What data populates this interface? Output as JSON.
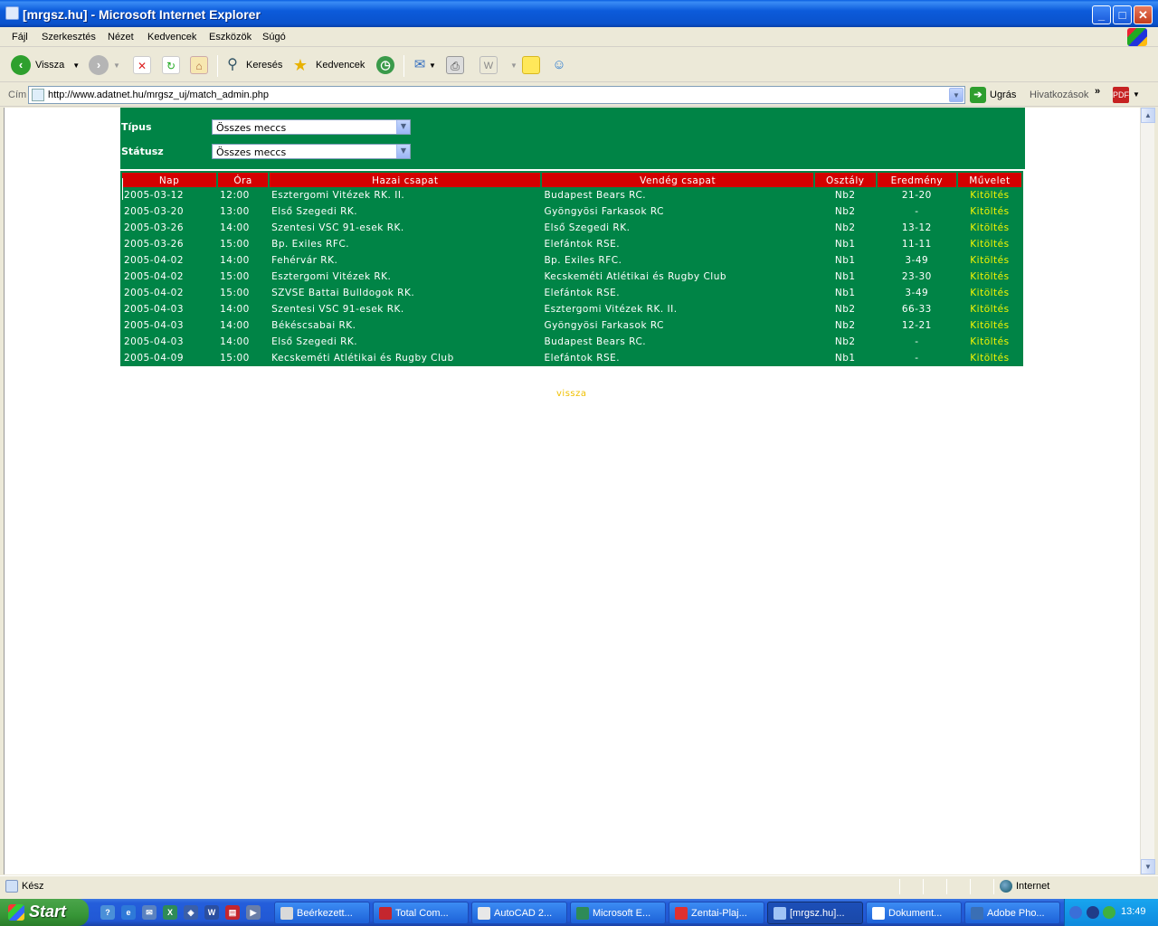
{
  "window": {
    "title": "[mrgsz.hu] - Microsoft Internet Explorer"
  },
  "menu": {
    "items": [
      "Fájl",
      "Szerkesztés",
      "Nézet",
      "Kedvencek",
      "Eszközök",
      "Súgó"
    ]
  },
  "toolbar": {
    "back_label": "Vissza",
    "search_label": "Keresés",
    "favorites_label": "Kedvencek"
  },
  "address": {
    "label": "Cím",
    "url": "http://www.adatnet.hu/mrgsz_uj/match_admin.php",
    "go_label": "Ugrás",
    "links_label": "Hivatkozások"
  },
  "filters": {
    "type_label": "Típus",
    "type_value": "Összes meccs",
    "status_label": "Státusz",
    "status_value": "Összes meccs"
  },
  "table": {
    "headers": [
      "Nap",
      "Óra",
      "Hazai csapat",
      "Vendég csapat",
      "Osztály",
      "Eredmény",
      "Művelet"
    ],
    "groups": [
      [
        [
          "2005-03-12",
          "12:00",
          "Esztergomi Vitézek RK. II.",
          "Budapest Bears RC.",
          "Nb2",
          "21-20",
          "Kitöltés"
        ]
      ],
      [
        [
          "2005-03-20",
          "13:00",
          "Első Szegedi RK.",
          "Gyöngyösi Farkasok RC",
          "Nb2",
          "-",
          "Kitöltés"
        ]
      ],
      [
        [
          "2005-03-26",
          "14:00",
          "Szentesi VSC 91-esek RK.",
          "Első Szegedi RK.",
          "Nb2",
          "13-12",
          "Kitöltés"
        ],
        [
          "2005-03-26",
          "15:00",
          "Bp. Exiles RFC.",
          "Elefántok RSE.",
          "Nb1",
          "11-11",
          "Kitöltés"
        ]
      ],
      [
        [
          "2005-04-02",
          "14:00",
          "Fehérvár RK.",
          "Bp. Exiles RFC.",
          "Nb1",
          "3-49",
          "Kitöltés"
        ],
        [
          "2005-04-02",
          "15:00",
          "Esztergomi Vitézek RK.",
          "Kecskeméti Atlétikai és Rugby Club",
          "Nb1",
          "23-30",
          "Kitöltés"
        ],
        [
          "2005-04-02",
          "15:00",
          "SZVSE Battai Bulldogok RK.",
          "Elefántok RSE.",
          "Nb1",
          "3-49",
          "Kitöltés"
        ],
        [
          "2005-04-03",
          "14:00",
          "Szentesi VSC 91-esek RK.",
          "Esztergomi Vitézek RK. II.",
          "Nb2",
          "66-33",
          "Kitöltés"
        ],
        [
          "2005-04-03",
          "14:00",
          "Békéscsabai RK.",
          "Gyöngyösi Farkasok RC",
          "Nb2",
          "12-21",
          "Kitöltés"
        ],
        [
          "2005-04-03",
          "14:00",
          "Első Szegedi RK.",
          "Budapest Bears RC.",
          "Nb2",
          "-",
          "Kitöltés"
        ]
      ],
      [
        [
          "2005-04-09",
          "15:00",
          "Kecskeméti Atlétikai és Rugby Club",
          "Elefántok RSE.",
          "Nb1",
          "-",
          "Kitöltés"
        ]
      ]
    ],
    "back_link": "vissza"
  },
  "status": {
    "text": "Kész",
    "zone": "Internet"
  },
  "taskbar": {
    "start_label": "Start",
    "tasks": [
      {
        "label": "Beérkezett...",
        "color": "#d9d9d9"
      },
      {
        "label": "Total Com...",
        "color": "#c4262e"
      },
      {
        "label": "AutoCAD 2...",
        "color": "#e8e8e8"
      },
      {
        "label": "Microsoft E...",
        "color": "#2e8b57"
      },
      {
        "label": "Zentai-Plaj...",
        "color": "#e03030"
      },
      {
        "label": "[mrgsz.hu]...",
        "color": "#9fc3f5"
      },
      {
        "label": "Dokument...",
        "color": "#ffffff"
      },
      {
        "label": "Adobe Pho...",
        "color": "#3a6fb5"
      }
    ],
    "clock": "13:49"
  },
  "colors": {
    "page_green": "#008446",
    "header_red": "#d40000",
    "action_yellow": "#f5f500",
    "back_link": "#f0c000"
  }
}
